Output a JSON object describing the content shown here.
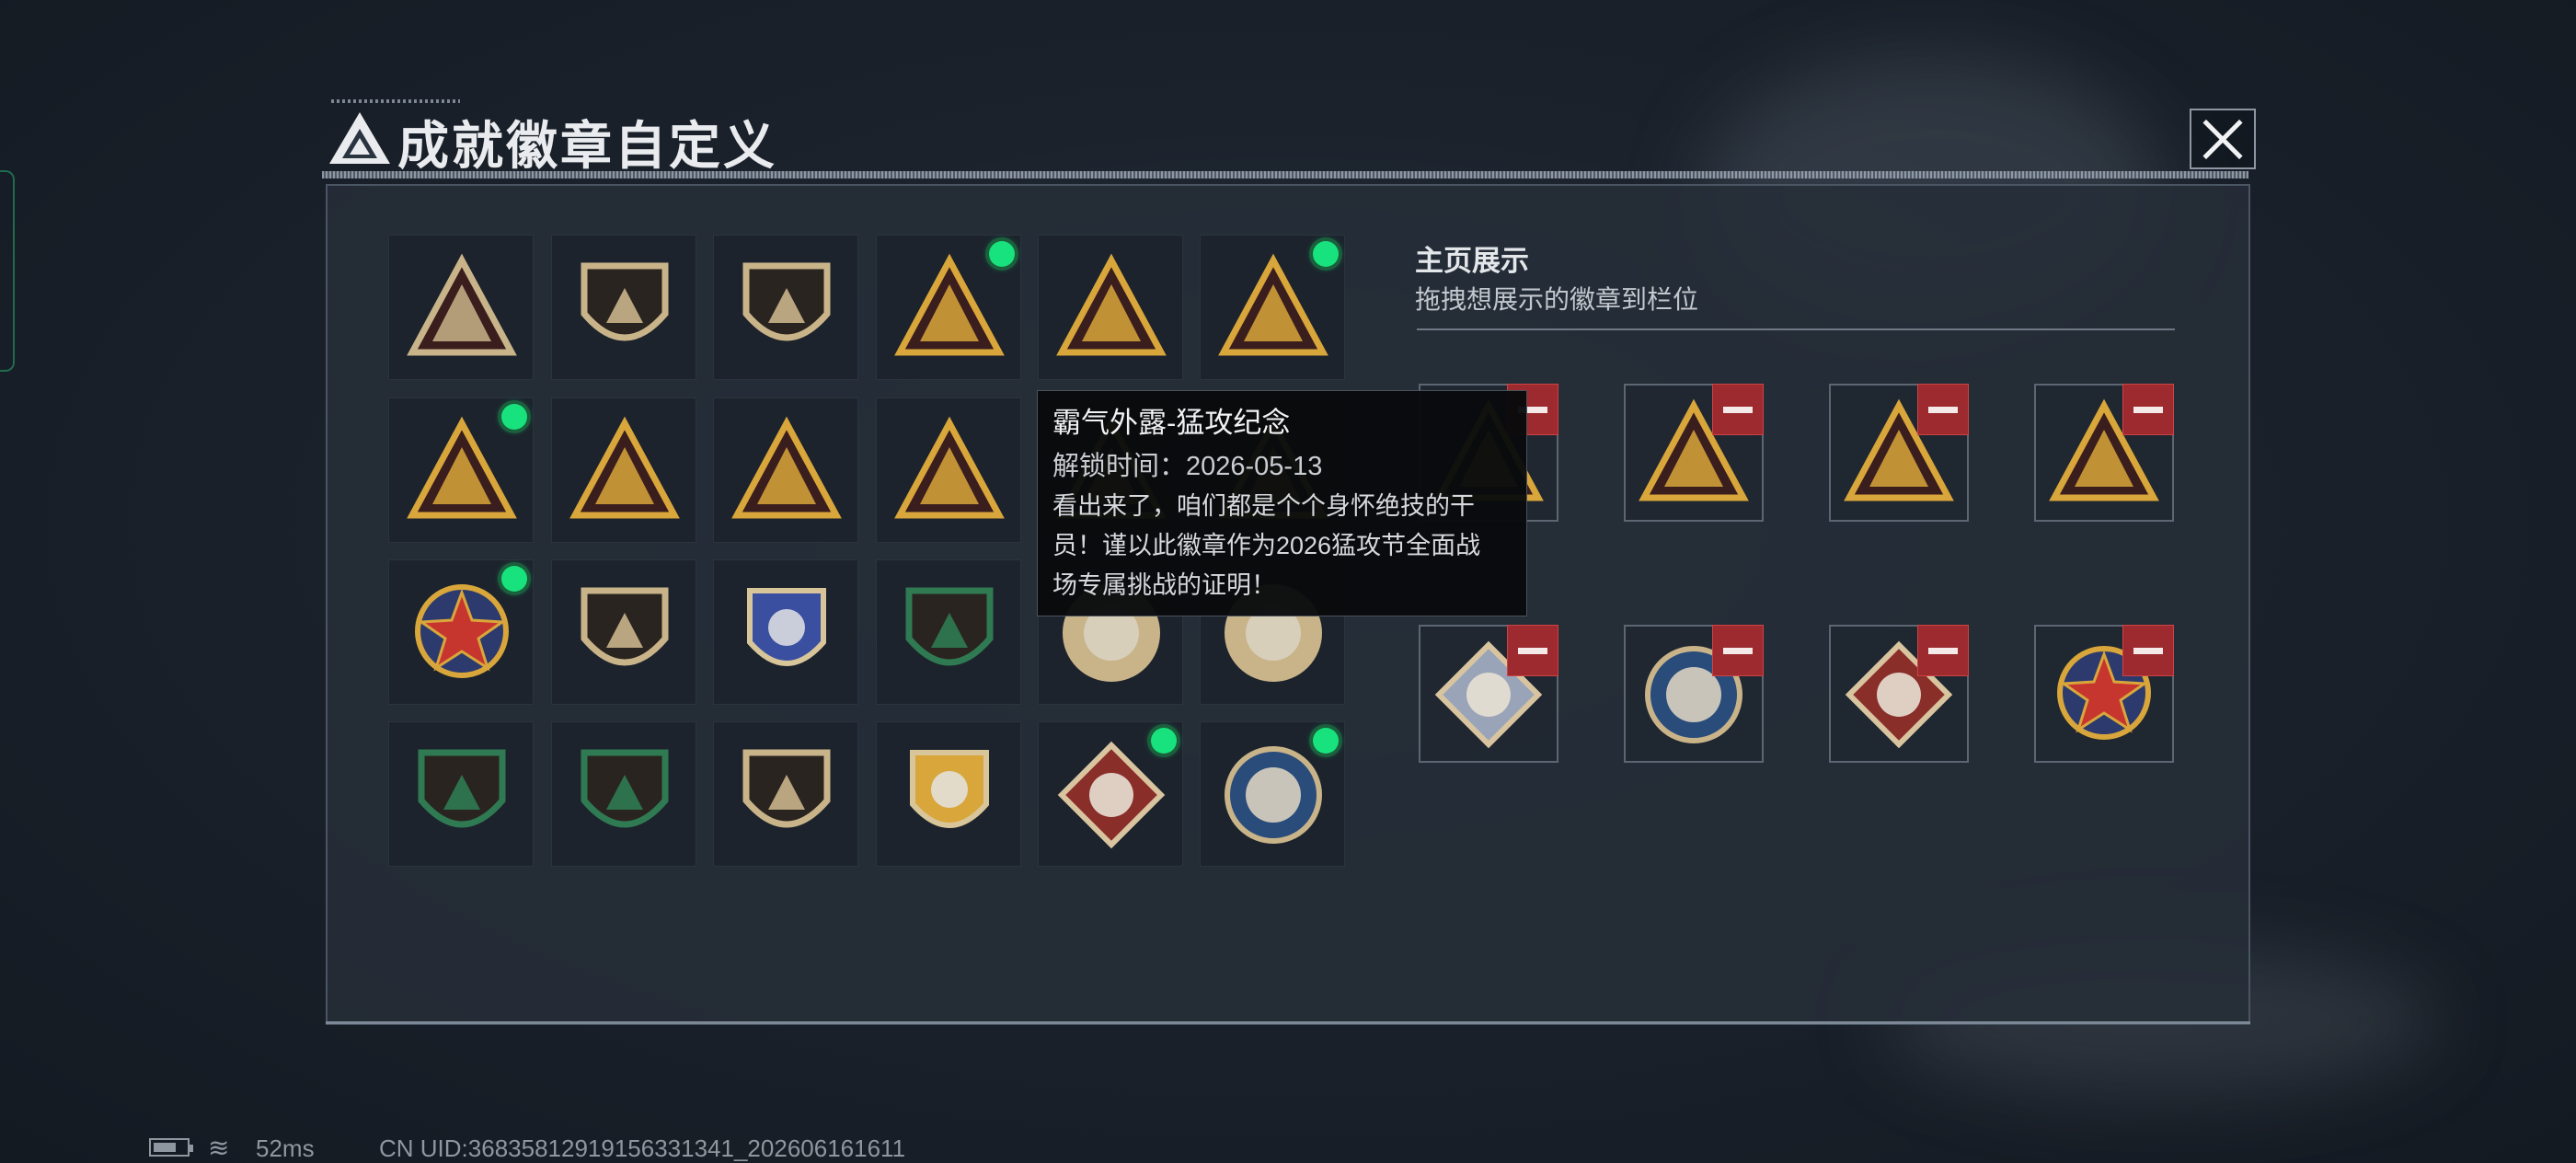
{
  "window": {
    "title": "成就徽章自定义"
  },
  "badges": [
    {
      "icon": "triangle-shield-badge",
      "color": "#c9b48a",
      "active": false
    },
    {
      "icon": "helicopter-shield-badge",
      "color": "#c9b48a",
      "active": false
    },
    {
      "icon": "dagger-shield-badge",
      "color": "#c9b48a",
      "active": false
    },
    {
      "icon": "vehicle-triangle-badge",
      "color": "#d8a63a",
      "active": true
    },
    {
      "icon": "rock-hand-triangle-badge",
      "color": "#d8a63a",
      "active": false
    },
    {
      "icon": "rocket-launcher-triangle-badge",
      "color": "#d8a63a",
      "active": true
    },
    {
      "icon": "boat-triangle-badge",
      "color": "#d8a63a",
      "active": true
    },
    {
      "icon": "number-one-triangle-badge",
      "color": "#d8a63a",
      "active": false
    },
    {
      "icon": "dice-triangle-badge",
      "color": "#d8a63a",
      "active": false
    },
    {
      "icon": "soldiers-triangle-badge",
      "color": "#d8a63a",
      "active": false
    },
    {
      "icon": "dragon-triangle-badge",
      "color": "#d8a63a",
      "active": false
    },
    {
      "icon": "wolf-triangle-badge",
      "color": "#d8a63a",
      "active": false
    },
    {
      "icon": "star-emblem-badge",
      "color": "#d8a63a",
      "active": true
    },
    {
      "icon": "chevron-shield-badge",
      "color": "#c9b48a",
      "active": false
    },
    {
      "icon": "blue-wing-shield-badge",
      "color": "#3a4fa0",
      "active": false
    },
    {
      "icon": "green-dice-shield-badge",
      "color": "#2f7a52",
      "active": false
    },
    {
      "icon": "lion-round-badge",
      "color": "#c9b48a",
      "active": false
    },
    {
      "icon": "tank-round-badge",
      "color": "#c9b48a",
      "active": false
    },
    {
      "icon": "crosshair-rifle-green-badge",
      "color": "#2f7a52",
      "active": false
    },
    {
      "icon": "crosshair-rifle-green-badge-2",
      "color": "#2f7a52",
      "active": false
    },
    {
      "icon": "rifle-shield-badge",
      "color": "#c9b48a",
      "active": false
    },
    {
      "icon": "gold-wing-crest-badge",
      "color": "#d8a63a",
      "active": false
    },
    {
      "icon": "wolf-diamond-badge",
      "color": "#8a2e2a",
      "active": true
    },
    {
      "icon": "wolf-round-blue-badge",
      "color": "#2a4c7a",
      "active": true
    }
  ],
  "tooltip": {
    "title": "霸气外露-猛攻纪念",
    "unlock": "解锁时间：2026-05-13",
    "desc_line1": "看出来了，咱们都是个个身怀绝技的干",
    "desc_line2": "员！谨以此徽章作为2026猛攻节全面战",
    "desc_line3": "场专属挑战的证明！"
  },
  "showcase": {
    "title": "主页展示",
    "subtitle": "拖拽想展示的徽章到栏位",
    "slots": [
      {
        "icon": "vehicle-triangle-badge",
        "color": "#d8a63a"
      },
      {
        "icon": "rocket-launcher-triangle-badge",
        "color": "#d8a63a"
      },
      {
        "icon": "rocket-hand-triangle-badge",
        "color": "#d8a63a"
      },
      {
        "icon": "boat-triangle-badge",
        "color": "#d8a63a"
      },
      {
        "icon": "robot-diamond-badge",
        "color": "#9aa4b8"
      },
      {
        "icon": "wolf-round-blue-badge",
        "color": "#2a4c7a"
      },
      {
        "icon": "wolf-diamond-badge",
        "color": "#8a2e2a"
      },
      {
        "icon": "star-emblem-badge",
        "color": "#d8a63a"
      }
    ]
  },
  "status_bar": {
    "ping": "52ms",
    "uid": "CN UID:36835812919156331341_202606161611"
  }
}
